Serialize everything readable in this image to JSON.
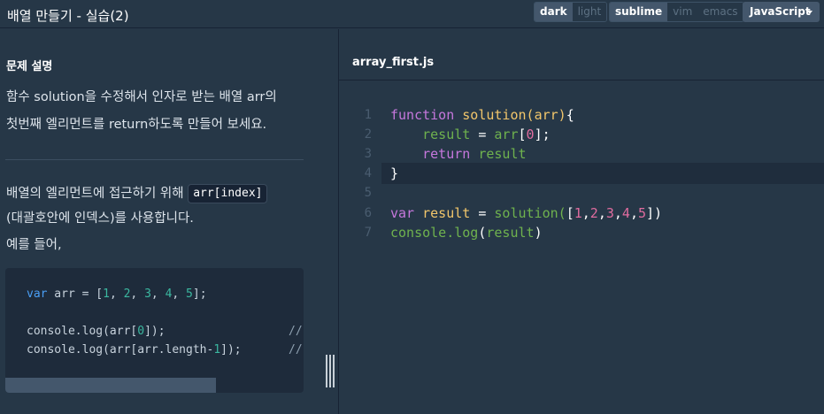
{
  "header": {
    "title": "배열 만들기 - 실습(2)",
    "theme_options": [
      "dark",
      "light"
    ],
    "keymap_options": [
      "sublime",
      "vim",
      "emacs"
    ],
    "language": "JavaScript"
  },
  "problem": {
    "section_title": "문제 설명",
    "desc_line1": "함수 solution을 수정해서 인자로 받는 배열 arr의",
    "desc_line2": "첫번째 엘리먼트를 return하도록 만들어 보세요.",
    "hint_prefix": "배열의 엘리먼트에 접근하기 위해 ",
    "hint_code": "arr[index]",
    "hint_line2": "(대괄호안에 인덱스)를 사용합니다.",
    "hint_line3": "예를 들어,",
    "example": {
      "line1_kw": "var",
      "line1_rest": " arr = [",
      "n1": "1",
      "n2": "2",
      "n3": "3",
      "n4": "4",
      "n5": "5",
      "line3_a": "console.log(arr[",
      "line3_idx": "0",
      "line3_b": "]);",
      "line4_a": "console.log(arr[arr.length-",
      "line4_idx": "1",
      "line4_b": "]);",
      "comment": "//"
    }
  },
  "editor": {
    "file_name": "array_first.js",
    "line_numbers": [
      "1",
      "2",
      "3",
      "4",
      "5",
      "6",
      "7"
    ],
    "tokens": {
      "function": "function",
      "solution": "solution",
      "arr": "arr",
      "result": "result",
      "return": "return",
      "var": "var",
      "console_log": "console.log",
      "zero": "0",
      "one": "1",
      "two": "2",
      "three": "3",
      "four": "4",
      "five": "5"
    }
  },
  "colors": {
    "background": "#263747",
    "keyword": "#c678dd",
    "function_name": "#f2c66b",
    "variable": "#6fb24e",
    "number": "#e06c9f"
  }
}
